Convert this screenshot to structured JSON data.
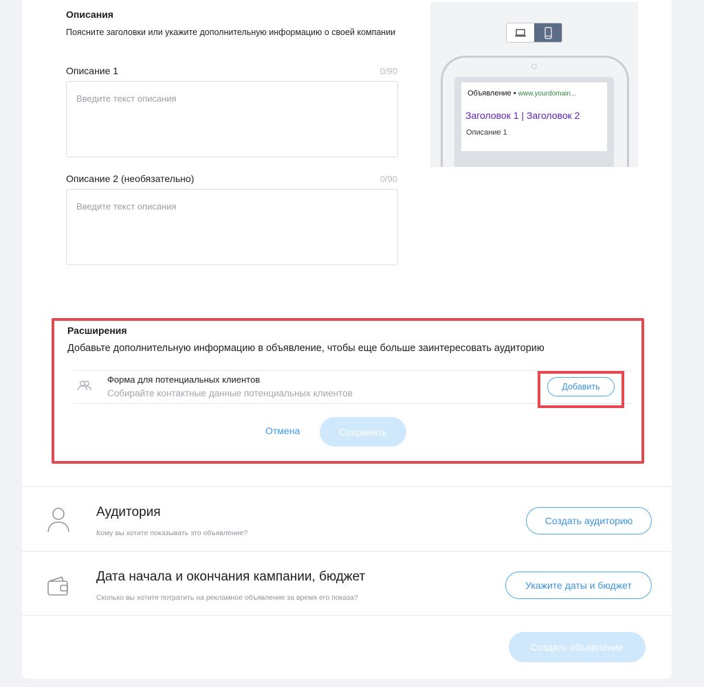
{
  "descriptions": {
    "title": "Описания",
    "hint": "Поясните заголовки или укажите дополнительную информацию о своей компании",
    "field1": {
      "label": "Описание 1",
      "counter": "0/90",
      "placeholder": "Введите текст описания"
    },
    "field2": {
      "label": "Описание 2 (необязательно)",
      "counter": "0/90",
      "placeholder": "Введите текст описания"
    }
  },
  "preview": {
    "devices": [
      {
        "icon": "laptop-icon",
        "selected": false
      },
      {
        "icon": "smartphone-icon",
        "selected": true
      }
    ],
    "ad_label": "Объявление",
    "ad_separator": "•",
    "ad_url": "www.yourdomain...",
    "ad_headline": "Заголовок 1 | Заголовок 2",
    "ad_description": "Описание 1"
  },
  "extensions": {
    "title": "Расширения",
    "hint": "Добавьте дополнительную информацию в объявление, чтобы еще больше заинтересовать аудиторию",
    "item": {
      "icon": "people-icon",
      "title": "Форма для потенциальных клиентов",
      "subtitle": "Собирайте контактные данные потенциальных клиентов",
      "add_label": "Добавить"
    },
    "cancel_label": "Отмена",
    "save_label": "Сохранить"
  },
  "audience": {
    "icon": "person-icon",
    "title": "Аудитория",
    "subtitle": "Кому вы хотите показывать это объявление?",
    "button_label": "Создать аудиторию"
  },
  "budget": {
    "icon": "wallet-icon",
    "title": "Дата начала и окончания кампании, бюджет",
    "subtitle": "Сколько вы хотите потратить на рекламное объявление за время его показа?",
    "button_label": "Укажите даты и бюджет"
  },
  "footer": {
    "create_label": "Создать объявление"
  },
  "colors": {
    "accent": "#3a93e0",
    "highlight": "#e5484f",
    "disabled_button": "#cfe8fb"
  }
}
